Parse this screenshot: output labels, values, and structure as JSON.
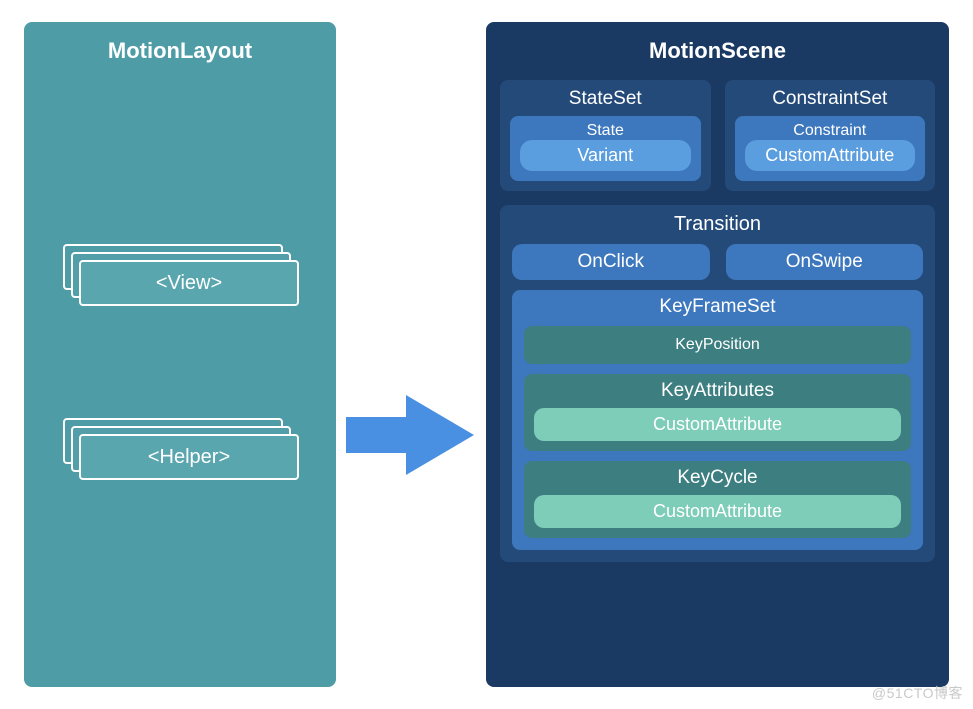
{
  "left": {
    "title": "MotionLayout",
    "stack1": "<View>",
    "stack2": "<Helper>"
  },
  "right": {
    "title": "MotionScene",
    "stateset": {
      "label": "StateSet",
      "state": "State",
      "variant": "Variant"
    },
    "constraintset": {
      "label": "ConstraintSet",
      "constraint": "Constraint",
      "custom": "CustomAttribute"
    },
    "transition": {
      "label": "Transition",
      "onclick": "OnClick",
      "onswipe": "OnSwipe",
      "kfs": {
        "label": "KeyFrameSet",
        "keyposition": "KeyPosition",
        "keyattributes": {
          "label": "KeyAttributes",
          "custom": "CustomAttribute"
        },
        "keycycle": {
          "label": "KeyCycle",
          "custom": "CustomAttribute"
        }
      }
    }
  },
  "watermark": "@51CTO博客"
}
